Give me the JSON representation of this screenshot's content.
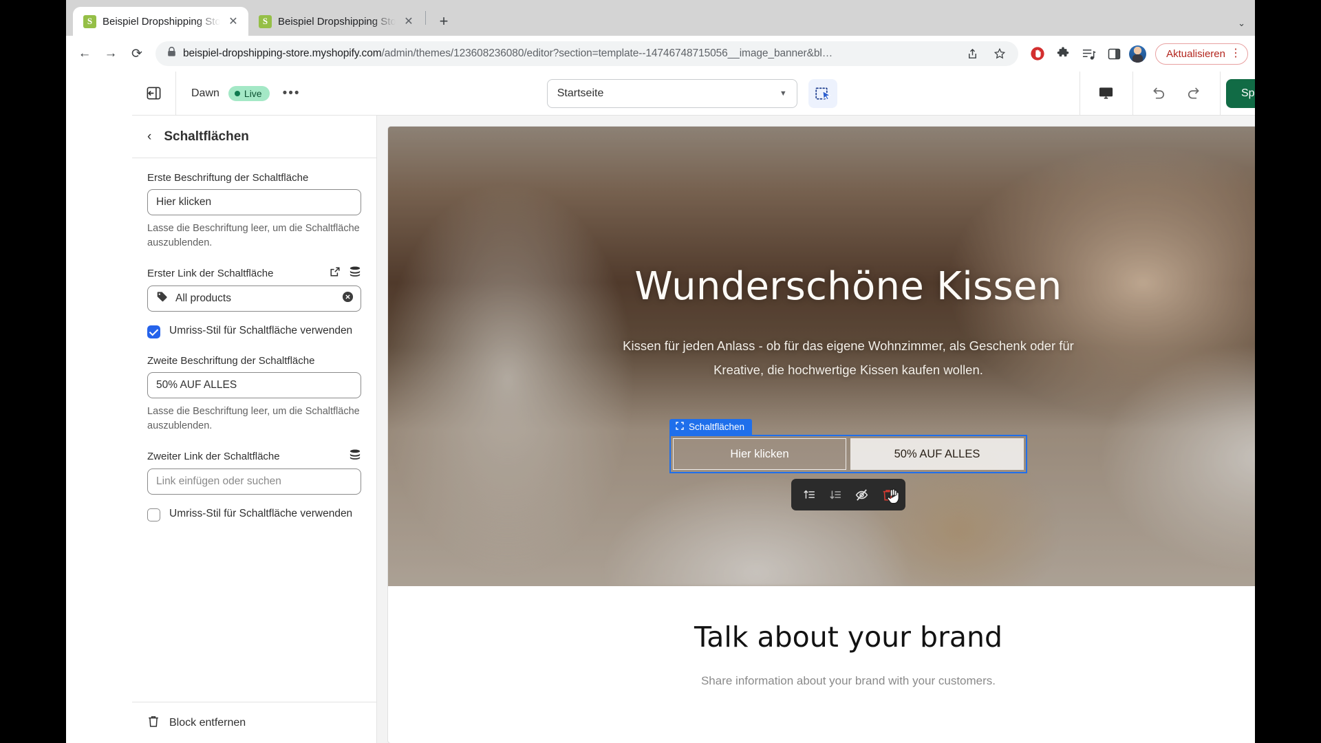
{
  "browser": {
    "tabs": [
      {
        "title": "Beispiel Dropshipping Store · D",
        "favicon": "shopify-icon",
        "active": true
      },
      {
        "title": "Beispiel Dropshipping Store · B",
        "favicon": "shopify-icon",
        "active": false
      }
    ],
    "newtab_label": "+",
    "nav": {
      "back": "←",
      "forward": "→",
      "reload": "⟳"
    },
    "url_main": "beispiel-dropshipping-store.myshopify.com",
    "url_path": "/admin/themes/123608236080/editor?section=template--14746748715056__image_banner&bl…",
    "lock_icon": "lock-icon",
    "actions": {
      "share": "share-icon",
      "bookmark": "star-icon",
      "adblock": "adblock-icon",
      "extensions": "puzzle-icon",
      "reading_list": "playlist-icon",
      "side_panel": "side-panel-icon",
      "profile": "avatar-icon",
      "update_label": "Aktualisieren",
      "menu": "kebab-menu-icon"
    }
  },
  "editor": {
    "exit_icon": "exit-editor-icon",
    "theme_name": "Dawn",
    "live_badge": "Live",
    "more_actions": "•••",
    "page_selector": {
      "value": "Startseite",
      "caret": "chevron-down-icon"
    },
    "inspector_icon": "inspector-select-icon",
    "device_icon": "desktop-preview-icon",
    "undo_icon": "undo-icon",
    "redo_icon": "redo-icon",
    "save_label": "Speichern"
  },
  "sidebar": {
    "back_icon": "chevron-left-icon",
    "title": "Schaltflächen",
    "fields": {
      "first_label_title": "Erste Beschriftung der Schaltfläche",
      "first_label_value": "Hier klicken",
      "first_label_help": "Lasse die Beschriftung leer, um die Schaltfläche auszublenden.",
      "first_link_title": "Erster Link der Schaltfläche",
      "first_link_value": "All products",
      "first_link_tag_icon": "price-tag-icon",
      "first_link_clear_icon": "clear-circle-icon",
      "first_link_external_icon": "external-link-icon",
      "first_link_stack_icon": "database-stack-icon",
      "first_outline_label": "Umriss-Stil für Schaltfläche verwenden",
      "first_outline_checked": true,
      "second_label_title": "Zweite Beschriftung der Schaltfläche",
      "second_label_value": "50% AUF ALLES",
      "second_label_help": "Lasse die Beschriftung leer, um die Schaltfläche auszublenden.",
      "second_link_title": "Zweiter Link der Schaltfläche",
      "second_link_placeholder": "Link einfügen oder suchen",
      "second_link_stack_icon": "database-stack-icon",
      "second_outline_label": "Umriss-Stil für Schaltfläche verwenden",
      "second_outline_checked": false
    },
    "footer": {
      "icon": "trash-icon",
      "label": "Block entfernen"
    }
  },
  "preview": {
    "hero": {
      "heading": "Wunderschöne Kissen",
      "subheading": "Kissen für jeden Anlass - ob für das eigene Wohnzimmer, als Geschenk oder für Kreative, die hochwertige Kissen kaufen wollen.",
      "button_one": "Hier klicken",
      "button_two": "50% AUF ALLES",
      "selection_tag": "Schaltflächen",
      "selection_tag_icon": "block-select-icon",
      "selection_color": "#1f6feb"
    },
    "floating_toolbar": {
      "move_up_icon": "move-up-icon",
      "move_down_icon": "move-down-icon",
      "hide_icon": "eye-slash-icon",
      "delete_icon": "trash-icon",
      "cursor_icon": "hand-pointer-cursor"
    },
    "brand_section": {
      "heading": "Talk about your brand",
      "body": "Share information about your brand with your customers."
    }
  }
}
